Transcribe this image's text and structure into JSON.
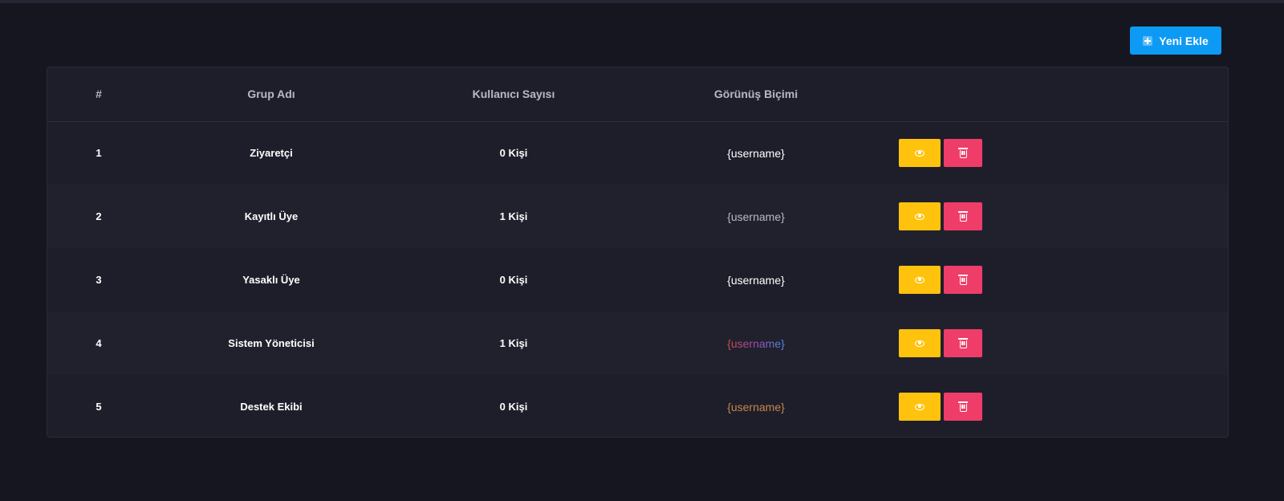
{
  "toolbar": {
    "add_label": "Yeni Ekle"
  },
  "table": {
    "headers": [
      "#",
      "Grup Adı",
      "Kullanıcı Sayısı",
      "Görünüş Biçimi",
      ""
    ],
    "rows": [
      {
        "id": "1",
        "name": "Ziyaretçi",
        "count": "0 Kişi",
        "format": "{username}",
        "format_color": "#ffffff"
      },
      {
        "id": "2",
        "name": "Kayıtlı Üye",
        "count": "1 Kişi",
        "format": "{username}",
        "format_color": "#b8b8c8"
      },
      {
        "id": "3",
        "name": "Yasaklı Üye",
        "count": "0 Kişi",
        "format": "{username}",
        "format_color": "#ffffff"
      },
      {
        "id": "4",
        "name": "Sistem Yöneticisi",
        "count": "1 Kişi",
        "format": "{username}",
        "format_color": "gradient-red-purple-blue"
      },
      {
        "id": "5",
        "name": "Destek Ekibi",
        "count": "0 Kişi",
        "format": "{username}",
        "format_color": "#c8864a"
      }
    ]
  },
  "icons": {
    "add": "plus-square-icon",
    "view": "eye-icon",
    "delete": "trash-icon"
  },
  "colors": {
    "background": "#161621",
    "card": "#1e1e2b",
    "primary": "#0d9af5",
    "warning": "#ffc20d",
    "danger": "#ee3d69"
  }
}
